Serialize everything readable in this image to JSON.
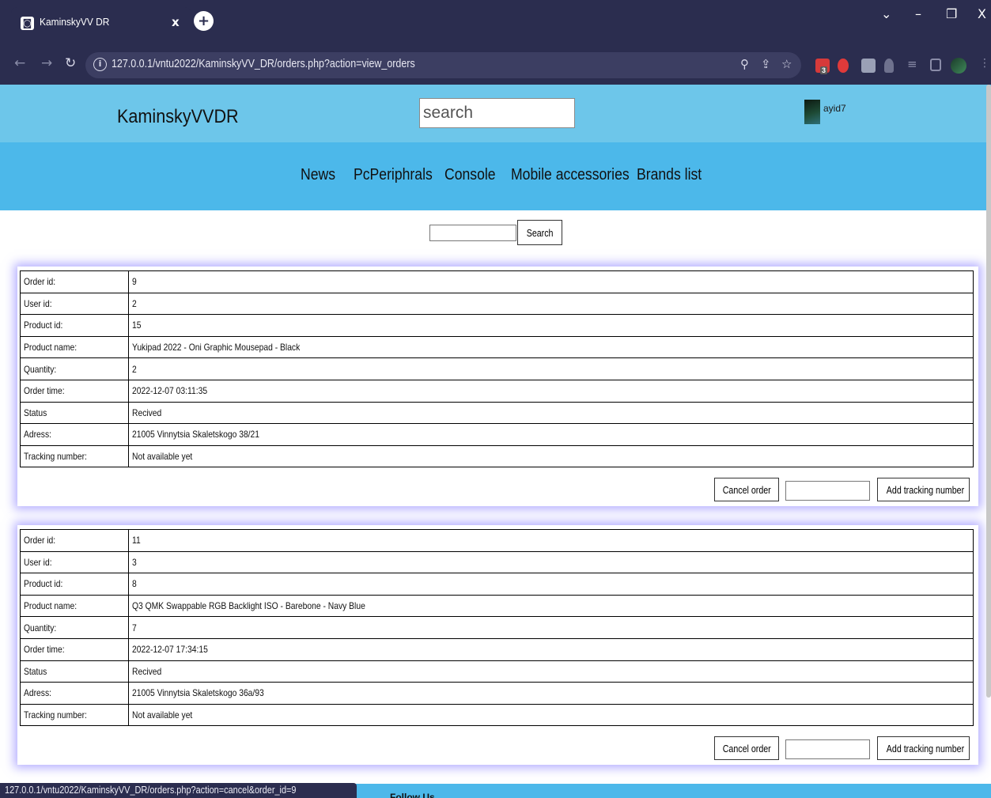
{
  "browser": {
    "tab_title": "KaminskyVV DR",
    "tab_close": "x",
    "new_tab": "+",
    "url": "127.0.0.1/vntu2022/KaminskyVV_DR/orders.php?action=view_orders",
    "ext_badge": "3",
    "status_url": "127.0.0.1/vntu2022/KaminskyVV_DR/orders.php?action=cancel&order_id=9"
  },
  "site": {
    "logo": "KaminskyVVDR",
    "search_placeholder": "search",
    "username": "ayid7",
    "nav": [
      "News",
      "PcPeriphrals",
      "Console",
      "Mobile accessories",
      "Brands list"
    ],
    "footer_text": "Follow Us"
  },
  "order_search": {
    "button": "Search",
    "value": ""
  },
  "orders": [
    {
      "rows": [
        {
          "label": "Order id:",
          "value": "9"
        },
        {
          "label": "User id:",
          "value": "2"
        },
        {
          "label": "Product id:",
          "value": "15"
        },
        {
          "label": "Product name:",
          "value": "Yukipad 2022 - Oni Graphic Mousepad - Black"
        },
        {
          "label": "Quantity:",
          "value": "2"
        },
        {
          "label": "Order time:",
          "value": "2022-12-07 03:11:35"
        },
        {
          "label": "Status",
          "value": "Recived"
        },
        {
          "label": "Adress:",
          "value": "21005 Vinnytsia Skaletskogo 38/21"
        },
        {
          "label": "Tracking number:",
          "value": "Not available yet"
        }
      ],
      "cancel_label": "Cancel order",
      "add_tracking_label": "Add tracking number",
      "tracking_input": ""
    },
    {
      "rows": [
        {
          "label": "Order id:",
          "value": "11"
        },
        {
          "label": "User id:",
          "value": "3"
        },
        {
          "label": "Product id:",
          "value": "8"
        },
        {
          "label": "Product name:",
          "value": "Q3 QMK Swappable RGB Backlight ISO - Barebone - Navy Blue"
        },
        {
          "label": "Quantity:",
          "value": "7"
        },
        {
          "label": "Order time:",
          "value": "2022-12-07 17:34:15"
        },
        {
          "label": "Status",
          "value": "Recived"
        },
        {
          "label": "Adress:",
          "value": "21005 Vinnytsia Skaletskogo 36a/93"
        },
        {
          "label": "Tracking number:",
          "value": "Not available yet"
        }
      ],
      "cancel_label": "Cancel order",
      "add_tracking_label": "Add tracking number",
      "tracking_input": ""
    }
  ],
  "colors": {
    "chrome": "#2b2d4f",
    "header_light": "#6dc6ea",
    "nav_blue": "#4cb8ea",
    "card_glow": "#786eff"
  }
}
